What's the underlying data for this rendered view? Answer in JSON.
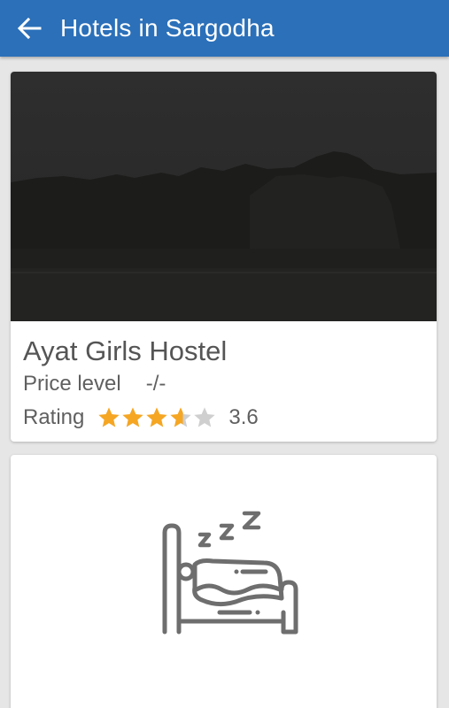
{
  "appbar": {
    "title": "Hotels in Sargodha",
    "back_icon": "arrow-left-icon",
    "color": "#2b70b9"
  },
  "hotels": [
    {
      "name": "Ayat Girls Hostel",
      "price_label": "Price level",
      "price_value": "-/-",
      "rating_label": "Rating",
      "rating_value": "3.6",
      "rating_stars": 3.6,
      "star_color": "#f5a623",
      "photo": "dusk-landscape-photo"
    },
    {
      "photo": "sleeping-bed-icon"
    }
  ]
}
